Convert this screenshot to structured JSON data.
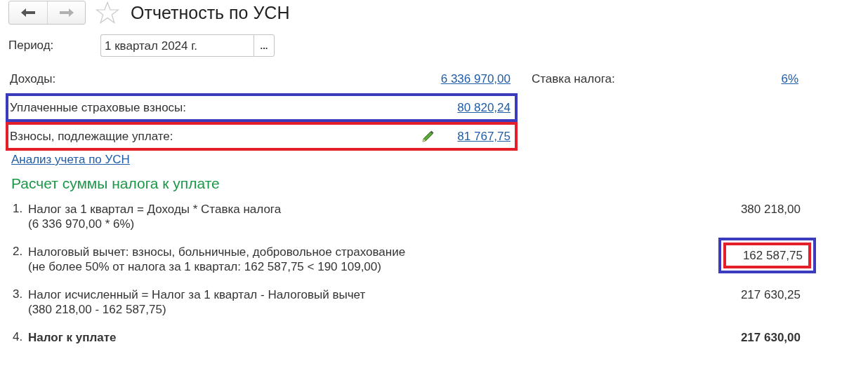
{
  "nav": {
    "back_disabled": false,
    "forward_disabled": true
  },
  "title": "Отчетность по УСН",
  "favorite": false,
  "period": {
    "label": "Период:",
    "value": "1 квартал 2024 г.",
    "button": "..."
  },
  "fields": [
    {
      "label": "Доходы:",
      "value": "6 336 970,00",
      "editable": false
    },
    {
      "label": "Уплаченные страховые взносы:",
      "value": "80 820,24",
      "editable": false,
      "color": "#3b3bbd"
    },
    {
      "label": "Взносы, подлежащие уплате:",
      "value": "81 767,75",
      "editable": true,
      "color": "#e3202a"
    }
  ],
  "rate": {
    "label": "Ставка налога:",
    "value": "6%"
  },
  "analysis_link": "Анализ учета по УСН",
  "section_title": "Расчет суммы налога к уплате",
  "steps": [
    {
      "number": "1.",
      "text": "Налог за 1 квартал = Доходы * Ставка налога",
      "detail": "(6 336 970,00 * 6%)",
      "value": "380 218,00",
      "bold": false
    },
    {
      "number": "2.",
      "text": "Налоговый вычет: взносы, больничные, добровольное страхование",
      "detail": "(не более 50% от налога за 1 квартал: 162 587,75 < 190 109,00)",
      "value": "162 587,75",
      "bold": false,
      "color": "#3b3bbd",
      "inner_frame": {
        "color": "#e3202a"
      }
    },
    {
      "number": "3.",
      "text": "Налог исчисленный = Налог за 1 квартал - Налоговый вычет",
      "detail": "(380 218,00 - 162 587,75)",
      "value": "217 630,25",
      "bold": false
    },
    {
      "number": "4.",
      "text": "Налог к уплате",
      "value": "217 630,00",
      "bold": true
    }
  ]
}
